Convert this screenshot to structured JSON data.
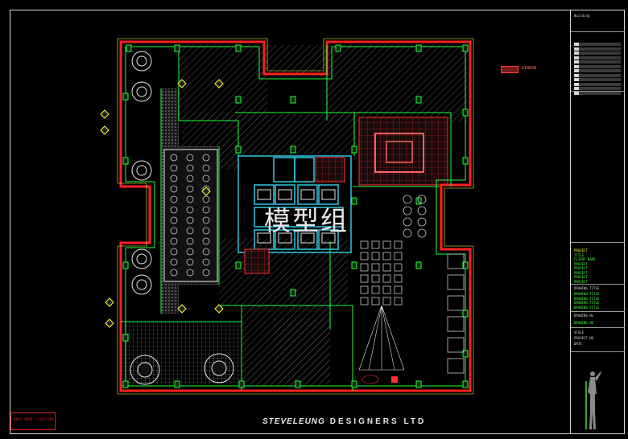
{
  "watermark": "模型组",
  "brand": {
    "part1": "STEVELEUNG",
    "part2": "DESIGNERS LTD"
  },
  "redbox_label": "SHEET NAME / LOCATION",
  "legend_label": "WINDOW",
  "title_block": {
    "top_label": "Building",
    "project_label": "PROJECT",
    "project_lines": [
      "TITLE",
      "CLIENT NAME",
      "PROJECT",
      "PROJECT",
      "PROJECT",
      "PROJECT",
      "PROJECT"
    ],
    "drawing_title_label": "DRAWING TITLE",
    "drawing_title_lines": [
      "DRAWING TITLE",
      "DRAWING TITLE",
      "DRAWING TITLE",
      "DRAWING TITLE"
    ],
    "drawing_no_label": "DRAWING No",
    "drawing_no": "DRAWING NO",
    "fields": [
      "SCALE",
      "PROJECT_NO",
      "DATE"
    ]
  },
  "colors": {
    "wall": "#ff2020",
    "green": "#20ff40",
    "yellow": "#ffff30",
    "cyan": "#30c8e0",
    "white": "#e8e8e8",
    "hatch": "#6a6a6a"
  }
}
